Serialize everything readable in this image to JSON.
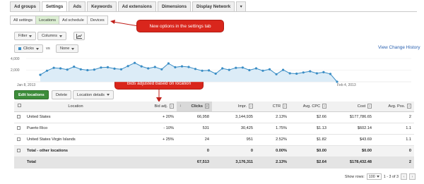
{
  "top_tabs": [
    "Ad groups",
    "Settings",
    "Ads",
    "Keywords",
    "Ad extensions",
    "Dimensions",
    "Display Network"
  ],
  "top_tabs_active": "Settings",
  "more_tab_label": "▾",
  "sub_tabs": [
    "All settings",
    "Locations",
    "Ad schedule",
    "Devices"
  ],
  "sub_tabs_active": "Locations",
  "callout_settings": "New options in the settings tab",
  "callout_bids": "Bids adjusted based on location",
  "toolbar": {
    "filter": "Filter",
    "columns": "Columns"
  },
  "graph_controls": {
    "metric": "Clicks",
    "vs": "vs",
    "compare": "None"
  },
  "view_change_history": "View Change History",
  "chart_data": {
    "type": "area",
    "series": [
      {
        "name": "Clicks",
        "values": [
          1200,
          1900,
          2400,
          2300,
          2100,
          2600,
          2150,
          2000,
          2100,
          2450,
          2500,
          2250,
          2150,
          2700,
          3250,
          2650,
          2300,
          2550,
          2150,
          3150,
          2500,
          2650,
          2550,
          2200,
          1900,
          1950,
          1400,
          2300,
          2050,
          2400,
          2450,
          2000,
          2300,
          1900,
          2150,
          1300,
          2050,
          1450,
          1400,
          1600,
          1800,
          1450,
          1650,
          1350,
          0
        ]
      }
    ],
    "ytick_labels": [
      "4,000",
      "2,000",
      "0"
    ],
    "ylim": [
      0,
      4000
    ],
    "x_start_label": "Jan 8, 2013",
    "x_end_label": "Feb 4, 2013",
    "color": "#3a8dc5",
    "fill": "#dcecf7",
    "grid": true
  },
  "actions": {
    "edit_locations": "Edit locations",
    "delete": "Delete",
    "location_details": "Location details"
  },
  "table": {
    "headers": {
      "location": "Location",
      "bid_adj": "Bid adj.",
      "clicks": "Clicks",
      "impr": "Impr.",
      "ctr": "CTR",
      "avg_cpc": "Avg. CPC",
      "cost": "Cost",
      "avg_pos": "Avg. Pos."
    },
    "rows": [
      {
        "location": "United States",
        "bid_adj": "+ 20%",
        "clicks": "66,958",
        "impr": "3,144,935",
        "ctr": "2.13%",
        "avg_cpc": "$2.66",
        "cost": "$177,786.65",
        "avg_pos": "2"
      },
      {
        "location": "Puerto Rico",
        "bid_adj": "- 10%",
        "clicks": "531",
        "impr": "30,425",
        "ctr": "1.75%",
        "avg_cpc": "$1.13",
        "cost": "$602.14",
        "avg_pos": "1.1"
      },
      {
        "location": "United States Virgin Islands",
        "bid_adj": "+ 25%",
        "clicks": "24",
        "impr": "951",
        "ctr": "2.52%",
        "avg_cpc": "$1.82",
        "cost": "$43.69",
        "avg_pos": "1.1"
      }
    ],
    "other_row": {
      "location": "Total - other locations",
      "clicks": "0",
      "impr": "0",
      "ctr": "0.00%",
      "avg_cpc": "$0.00",
      "cost": "$0.00",
      "avg_pos": "0"
    },
    "total_row": {
      "location": "Total",
      "clicks": "67,513",
      "impr": "3,176,311",
      "ctr": "2.13%",
      "avg_cpc": "$2.64",
      "cost": "$178,432.48",
      "avg_pos": "2"
    }
  },
  "footer": {
    "show_rows_label": "Show rows:",
    "show_rows_value": "100",
    "range": "1 - 3 of 3"
  }
}
